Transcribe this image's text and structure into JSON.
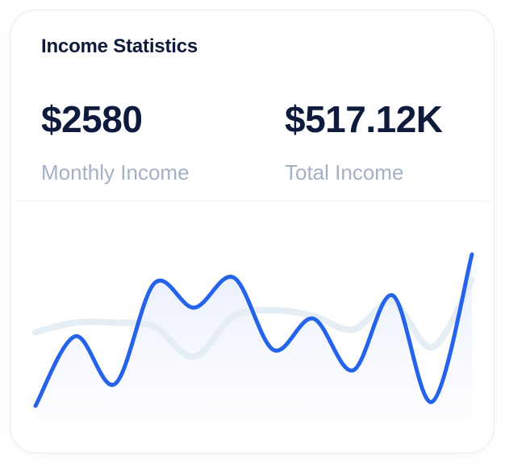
{
  "card": {
    "title": "Income Statistics"
  },
  "metrics": [
    {
      "value": "$2580",
      "label": "Monthly Income"
    },
    {
      "value": "$517.12K",
      "label": "Total Income"
    }
  ],
  "colors": {
    "primary_line": "#2563eb",
    "secondary_line": "#e5edf5",
    "area_fill_top": "#dfe8fb",
    "area_fill_bottom": "#f6f8fe",
    "title": "#0f1b3d",
    "label": "#a3b1c6"
  },
  "chart_data": {
    "type": "line",
    "series": [
      {
        "values": [
          9,
          60,
          25,
          99,
          81,
          103,
          50,
          73,
          35,
          90,
          12,
          120
        ]
      },
      {
        "values": [
          63,
          70,
          70,
          67,
          45,
          75,
          79,
          75,
          65,
          85,
          52,
          101
        ]
      }
    ],
    "ylim": [
      0,
      130
    ]
  }
}
